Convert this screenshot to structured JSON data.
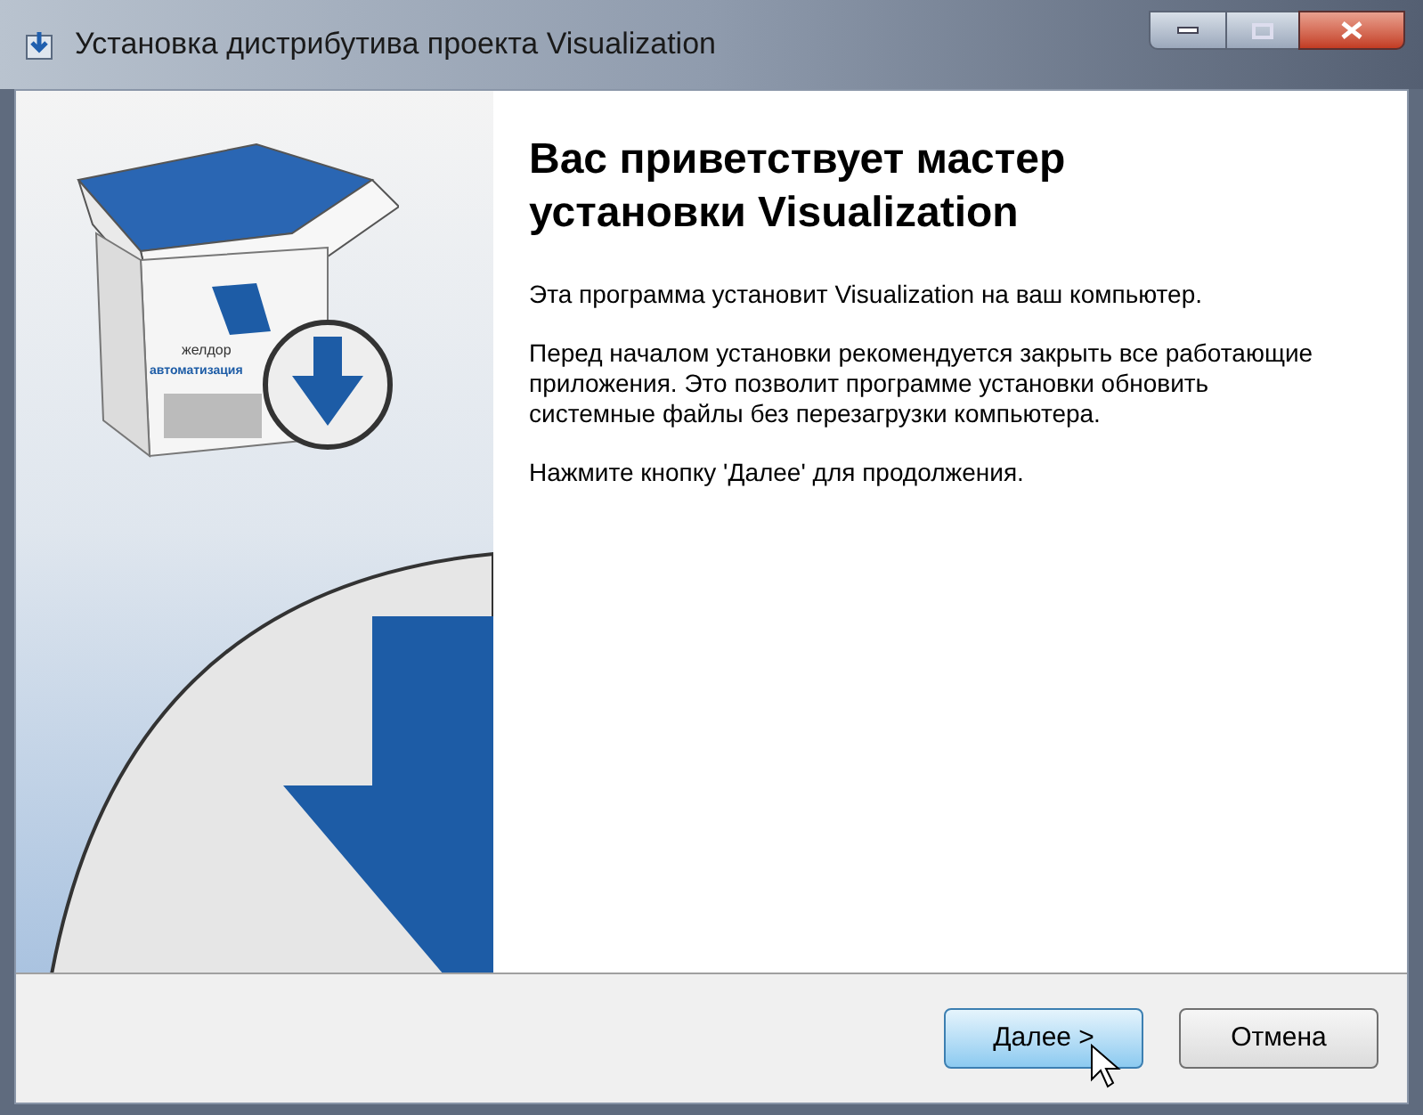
{
  "window": {
    "title": "Установка дистрибутива проекта Visualization"
  },
  "banner": {
    "logo_lines": [
      "желдор",
      "автоматизация"
    ]
  },
  "heading": "Вас приветствует мастер установки Visualization",
  "paragraphs": [
    "Эта программа установит Visualization на ваш компьютер.",
    "Перед началом установки рекомендуется закрыть все работающие приложения. Это позволит программе установки обновить системные файлы без перезагрузки компьютера.",
    "Нажмите кнопку 'Далее' для продолжения."
  ],
  "buttons": [
    {
      "label": "Далее >",
      "hovered": true
    },
    {
      "label": "Отмена",
      "hovered": false
    }
  ]
}
